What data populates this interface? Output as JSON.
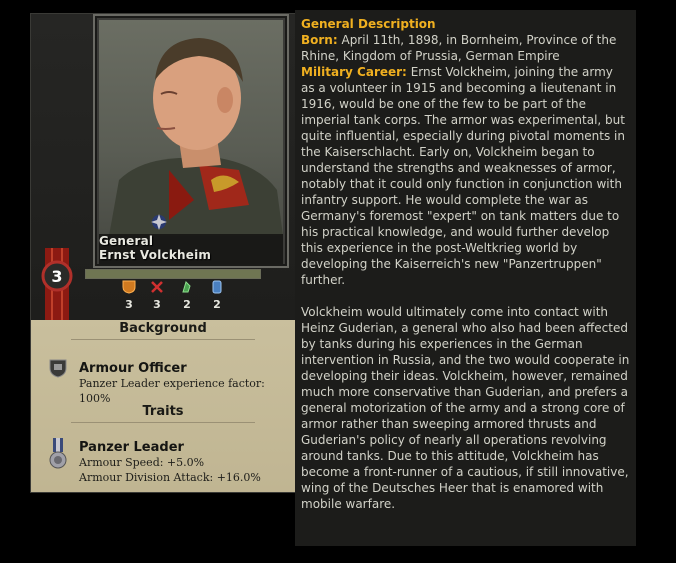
{
  "general": {
    "rank": "General",
    "name": "Ernst Volckheim",
    "skill": "3",
    "xp_fraction": 1.0
  },
  "stats": [
    {
      "icon": "shield-icon",
      "value": "3"
    },
    {
      "icon": "crossed-swords-icon",
      "value": "3"
    },
    {
      "icon": "planning-icon",
      "value": "2"
    },
    {
      "icon": "logistics-icon",
      "value": "2"
    }
  ],
  "background": {
    "heading": "Background",
    "title": "Armour Officer",
    "desc": "Panzer Leader experience factor: 100%"
  },
  "traits": {
    "heading": "Traits",
    "title": "Panzer Leader",
    "line1": "Armour Speed: +5.0%",
    "line2": "Armour Division Attack: +16.0%"
  },
  "description": {
    "title": "General Description",
    "born_label": "Born:",
    "born_text": "April 11th, 1898, in Bornheim, Province of the Rhine, Kingdom of Prussia, German Empire",
    "career_label": "Military Career:",
    "career_text": "Ernst Volckheim, joining the army as a volunteer in 1915 and becoming a lieutenant in 1916, would be one of the few to be part of the imperial tank corps. The armor was experimental, but quite influential, especially during pivotal moments in the Kaiserschlacht. Early on, Volckheim began to understand the strengths and weaknesses of armor, notably that it could only function in conjunction with infantry support. He would complete the war as Germany's foremost \"expert\" on tank matters due to his practical knowledge, and would further develop this experience in the post-Weltkrieg world by developing the Kaiserreich's new \"Panzertruppen\" further.",
    "paragraph2": "Volckheim would ultimately come into contact with Heinz Guderian, a general who also had been affected by tanks during his experiences in the German intervention in Russia, and the two would cooperate in developing their ideas. Volckheim, however, remained much more conservative than Guderian, and prefers a general motorization of the army and a strong core of armor rather than sweeping armored thrusts and Guderian's policy of nearly all operations revolving around tanks. Due to this attitude, Volckheim has become a front-runner of a cautious, if still innovative, wing of the Deutsches Heer that is enamored with mobile warfare."
  },
  "colors": {
    "accent": "#f0b020",
    "parchment": "#c9bf9d",
    "panel": "#1c1c1a"
  }
}
